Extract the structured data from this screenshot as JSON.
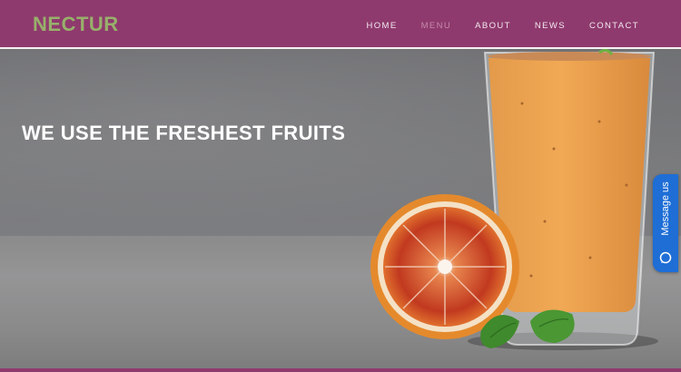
{
  "header": {
    "logo": "NECTUR",
    "nav": [
      {
        "label": "HOME",
        "active": false
      },
      {
        "label": "MENU",
        "active": true
      },
      {
        "label": "ABOUT",
        "active": false
      },
      {
        "label": "NEWS",
        "active": false
      },
      {
        "label": "CONTACT",
        "active": false
      }
    ]
  },
  "hero": {
    "title": "WE USE THE FRESHEST FRUITS",
    "image_subject": [
      "smoothie-glass",
      "blood-orange-half",
      "mint-leaves"
    ]
  },
  "message_widget": {
    "label": "Message us",
    "icon": "chat-bubble-icon"
  },
  "colors": {
    "header_bg": "#8f3a6e",
    "logo": "#98b06b",
    "nav_active": "#c48aaa",
    "widget_bg": "#1e6ed6"
  }
}
